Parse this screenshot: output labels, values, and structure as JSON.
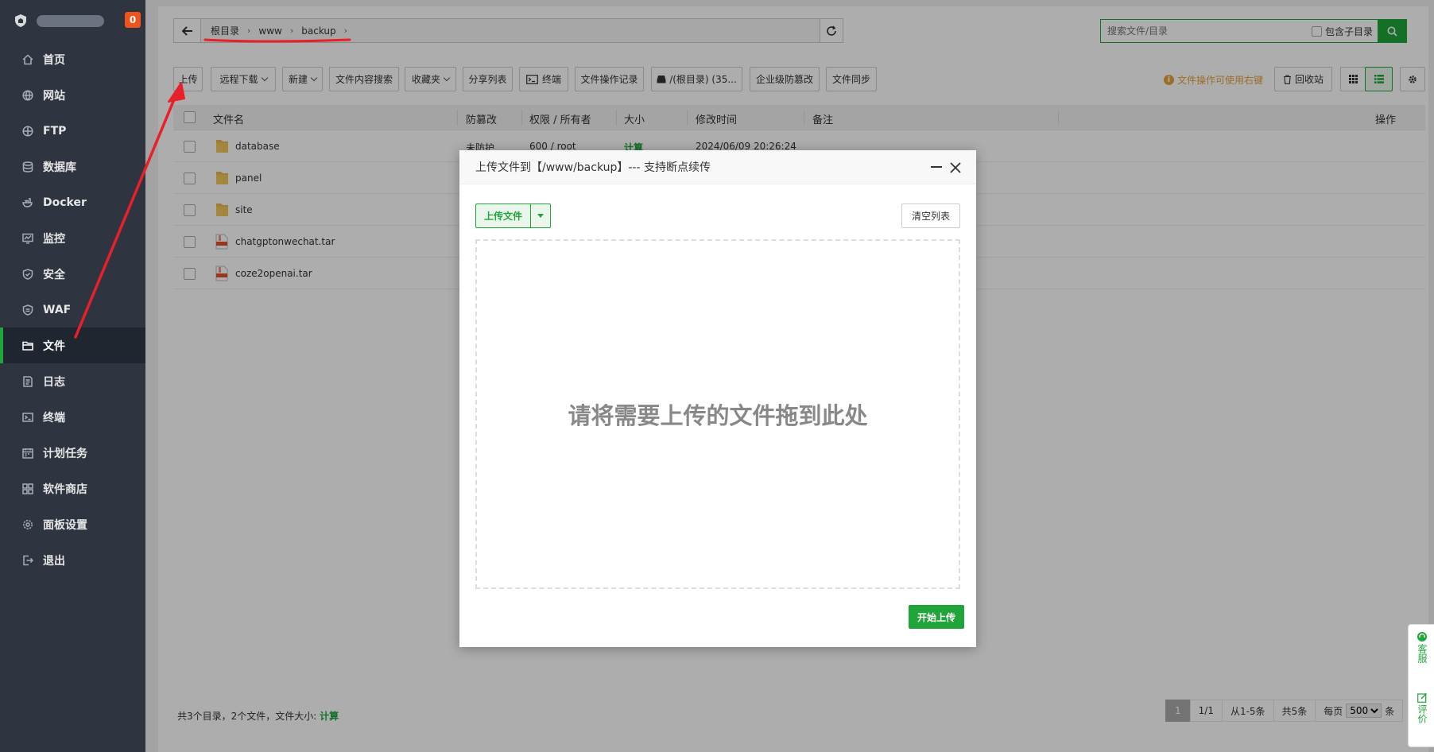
{
  "sidebar": {
    "badge": "0",
    "items": [
      {
        "label": "首页",
        "icon": "home-icon"
      },
      {
        "label": "网站",
        "icon": "globe-icon"
      },
      {
        "label": "FTP",
        "icon": "ftp-icon"
      },
      {
        "label": "数据库",
        "icon": "database-icon"
      },
      {
        "label": "Docker",
        "icon": "docker-icon"
      },
      {
        "label": "监控",
        "icon": "monitor-icon"
      },
      {
        "label": "安全",
        "icon": "shield-icon"
      },
      {
        "label": "WAF",
        "icon": "waf-icon"
      },
      {
        "label": "文件",
        "icon": "folder-icon"
      },
      {
        "label": "日志",
        "icon": "log-icon"
      },
      {
        "label": "终端",
        "icon": "terminal-icon"
      },
      {
        "label": "计划任务",
        "icon": "calendar-icon"
      },
      {
        "label": "软件商店",
        "icon": "grid-icon"
      },
      {
        "label": "面板设置",
        "icon": "gear-icon"
      },
      {
        "label": "退出",
        "icon": "logout-icon"
      }
    ],
    "active_index": 8
  },
  "path": {
    "crumbs": [
      "根目录",
      "www",
      "backup"
    ]
  },
  "search": {
    "placeholder": "搜索文件/目录",
    "include_sub": "包含子目录"
  },
  "toolbar": {
    "upload": "上传",
    "remote_download": "远程下载",
    "new": "新建",
    "content_search": "文件内容搜索",
    "favorites": "收藏夹",
    "share_list": "分享列表",
    "terminal": "终端",
    "op_log": "文件操作记录",
    "disk": "/(根目录) (35...",
    "tamper": "企业级防篡改",
    "sync": "文件同步",
    "hint": "文件操作可使用右键",
    "recycle": "回收站"
  },
  "table": {
    "headers": {
      "name": "文件名",
      "tamper": "防篡改",
      "perm": "权限 / 所有者",
      "size": "大小",
      "mtime": "修改时间",
      "note": "备注",
      "ops": "操作"
    },
    "rows": [
      {
        "name": "database",
        "type": "folder",
        "tamper": "未防护",
        "perm": "600 / root",
        "size": "计算",
        "mtime": "2024/06/09 20:26:24"
      },
      {
        "name": "panel",
        "type": "folder"
      },
      {
        "name": "site",
        "type": "folder"
      },
      {
        "name": "chatgptonwechat.tar",
        "type": "file"
      },
      {
        "name": "coze2openai.tar",
        "type": "file"
      }
    ]
  },
  "footer": {
    "summary": "共3个目录，2个文件，文件大小:",
    "calc": "计算"
  },
  "pager": {
    "current": "1",
    "pages": "1/1",
    "range": "从1-5条",
    "total": "共5条",
    "per_page_label": "每页",
    "per_page_value": "500",
    "unit": "条"
  },
  "dialog": {
    "title": "上传文件到【/www/backup】--- 支持断点续传",
    "upload_file": "上传文件",
    "clear_list": "清空列表",
    "drop_hint": "请将需要上传的文件拖到此处",
    "start_upload": "开始上传"
  },
  "float_help": {
    "service": "客服",
    "review": "评价"
  },
  "colors": {
    "accent": "#20a53a",
    "sidebar_bg": "#2e3440",
    "badge": "#f0541b",
    "hint": "#e6a23c",
    "annotation": "#e8202a"
  }
}
